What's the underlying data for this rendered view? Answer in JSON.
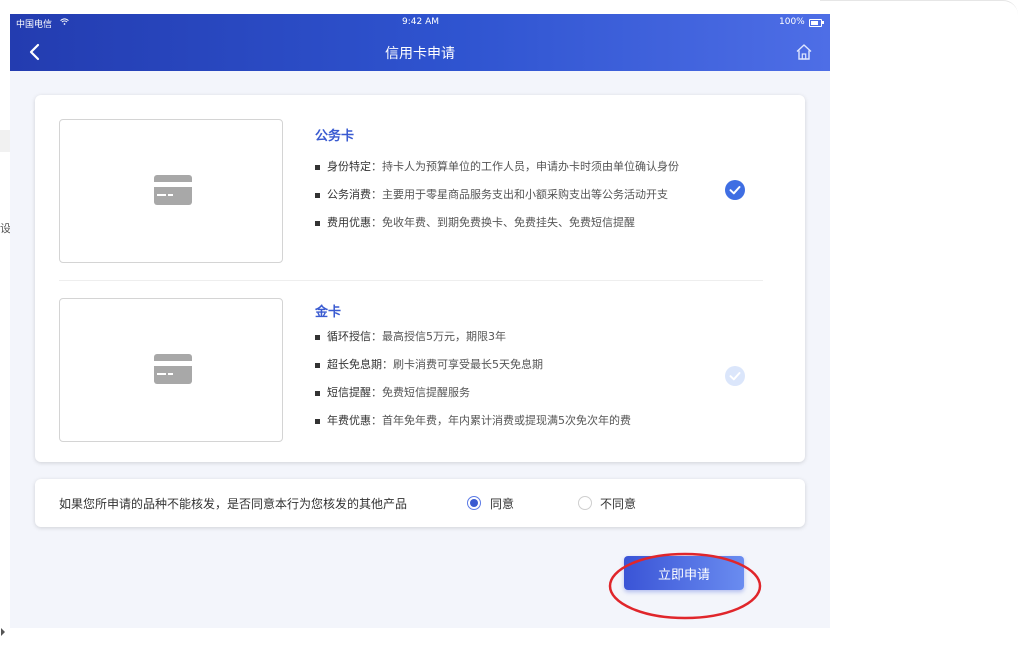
{
  "status_bar": {
    "carrier": "中国电信",
    "time": "9:42 AM",
    "battery": "100%"
  },
  "header": {
    "title": "信用卡申请",
    "back_icon": "chevron-left-icon",
    "home_icon": "home-icon"
  },
  "left_edge": {
    "partial_text": "设"
  },
  "cards": [
    {
      "title": "公务卡",
      "selected": true,
      "image_icon": "credit-card-icon",
      "features": [
        {
          "label": "身份特定",
          "text": "：持卡人为预算单位的工作人员，申请办卡时须由单位确认身份"
        },
        {
          "label": "公务消费",
          "text": "：主要用于零星商品服务支出和小额采购支出等公务活动开支"
        },
        {
          "label": "费用优惠",
          "text": "：免收年费、到期免费换卡、免费挂失、免费短信提醒"
        }
      ]
    },
    {
      "title": "金卡",
      "selected": false,
      "image_icon": "credit-card-icon",
      "features": [
        {
          "label": "循环授信",
          "text": "：最高授信5万元，期限3年"
        },
        {
          "label": "超长免息期",
          "text": "：刷卡消费可享受最长5天免息期"
        },
        {
          "label": "短信提醒",
          "text": "：免费短信提醒服务"
        },
        {
          "label": "年费优惠",
          "text": "：首年免年费，年内累计消费或提现满5次免次年的费"
        }
      ]
    }
  ],
  "consent": {
    "question": "如果您所申请的品种不能核发，是否同意本行为您核发的其他产品",
    "options": [
      {
        "label": "同意",
        "selected": true
      },
      {
        "label": "不同意",
        "selected": false
      }
    ]
  },
  "apply_button_label": "立即申请",
  "colors": {
    "primary": "#3a5bd1",
    "header_gradient_start": "#233cb0",
    "header_gradient_end": "#4e6ee6",
    "annotation_red": "#e0262b"
  }
}
